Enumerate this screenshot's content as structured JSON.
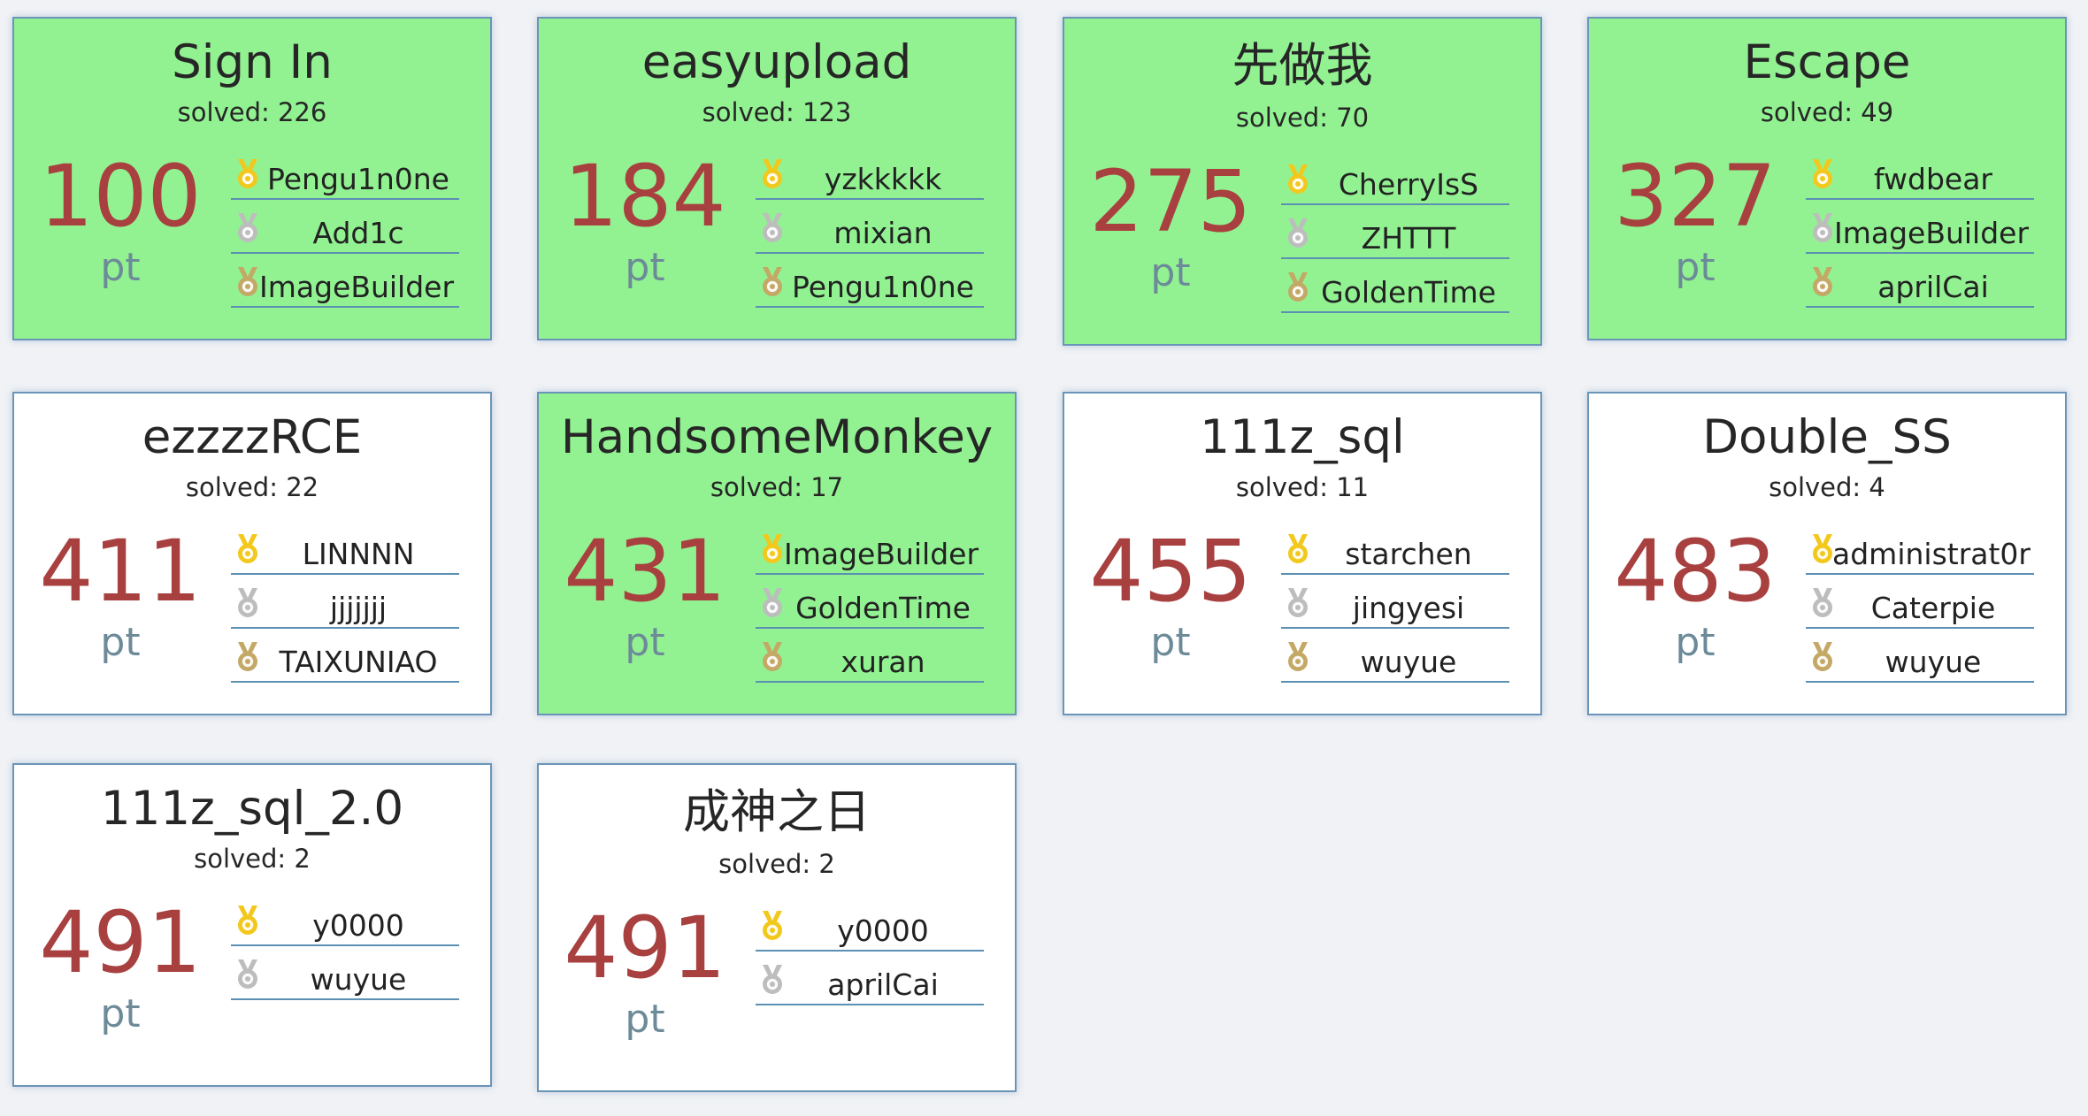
{
  "colors": {
    "solved_background": "#92f292",
    "unsolved_background": "#ffffff",
    "points": "#a8403f",
    "pt_label": "#6c8a98",
    "gold_medal": "#f2c81c",
    "silver_medal": "#bdbdbd",
    "bronze_medal": "#c4a866"
  },
  "challenges": [
    {
      "title": "Sign In",
      "solves": "solved: 226",
      "points": "100",
      "unit": "pt",
      "solved_by_me": true,
      "bloods": [
        {
          "medal": "gold-medal-icon",
          "name": "Pengu1n0ne"
        },
        {
          "medal": "silver-medal-icon",
          "name": "Add1c"
        },
        {
          "medal": "bronze-medal-icon",
          "name": "ImageBuilder"
        }
      ]
    },
    {
      "title": "easyupload",
      "solves": "solved: 123",
      "points": "184",
      "unit": "pt",
      "solved_by_me": true,
      "bloods": [
        {
          "medal": "gold-medal-icon",
          "name": "yzkkkkk"
        },
        {
          "medal": "silver-medal-icon",
          "name": "mixian"
        },
        {
          "medal": "bronze-medal-icon",
          "name": "Pengu1n0ne"
        }
      ]
    },
    {
      "title": "先做我",
      "solves": "solved: 70",
      "points": "275",
      "unit": "pt",
      "solved_by_me": true,
      "bloods": [
        {
          "medal": "gold-medal-icon",
          "name": "CherryIsS"
        },
        {
          "medal": "silver-medal-icon",
          "name": "ZHTTT"
        },
        {
          "medal": "bronze-medal-icon",
          "name": "GoldenTime"
        }
      ]
    },
    {
      "title": "Escape",
      "solves": "solved: 49",
      "points": "327",
      "unit": "pt",
      "solved_by_me": true,
      "bloods": [
        {
          "medal": "gold-medal-icon",
          "name": "fwdbear"
        },
        {
          "medal": "silver-medal-icon",
          "name": "ImageBuilder"
        },
        {
          "medal": "bronze-medal-icon",
          "name": "aprilCai"
        }
      ]
    },
    {
      "title": "ezzzzRCE",
      "solves": "solved: 22",
      "points": "411",
      "unit": "pt",
      "solved_by_me": false,
      "bloods": [
        {
          "medal": "gold-medal-icon",
          "name": "LINNNN"
        },
        {
          "medal": "silver-medal-icon",
          "name": "jjjjjjj"
        },
        {
          "medal": "bronze-medal-icon",
          "name": "TAIXUNIAO"
        }
      ]
    },
    {
      "title": "HandsomeMonkey",
      "solves": "solved: 17",
      "points": "431",
      "unit": "pt",
      "solved_by_me": true,
      "bloods": [
        {
          "medal": "gold-medal-icon",
          "name": "ImageBuilder"
        },
        {
          "medal": "silver-medal-icon",
          "name": "GoldenTime"
        },
        {
          "medal": "bronze-medal-icon",
          "name": "xuran"
        }
      ]
    },
    {
      "title": "111z_sql",
      "solves": "solved: 11",
      "points": "455",
      "unit": "pt",
      "solved_by_me": false,
      "bloods": [
        {
          "medal": "gold-medal-icon",
          "name": "starchen"
        },
        {
          "medal": "silver-medal-icon",
          "name": "jingyesi"
        },
        {
          "medal": "bronze-medal-icon",
          "name": "wuyue"
        }
      ]
    },
    {
      "title": "Double_SS",
      "solves": "solved: 4",
      "points": "483",
      "unit": "pt",
      "solved_by_me": false,
      "bloods": [
        {
          "medal": "gold-medal-icon",
          "name": "administrat0r"
        },
        {
          "medal": "silver-medal-icon",
          "name": "Caterpie"
        },
        {
          "medal": "bronze-medal-icon",
          "name": "wuyue"
        }
      ]
    },
    {
      "title": "111z_sql_2.0",
      "solves": "solved: 2",
      "points": "491",
      "unit": "pt",
      "solved_by_me": false,
      "bloods": [
        {
          "medal": "gold-medal-icon",
          "name": "y0000"
        },
        {
          "medal": "silver-medal-icon",
          "name": "wuyue"
        }
      ]
    },
    {
      "title": "成神之日",
      "solves": "solved: 2",
      "points": "491",
      "unit": "pt",
      "solved_by_me": false,
      "bloods": [
        {
          "medal": "gold-medal-icon",
          "name": "y0000"
        },
        {
          "medal": "silver-medal-icon",
          "name": "aprilCai"
        }
      ]
    }
  ]
}
